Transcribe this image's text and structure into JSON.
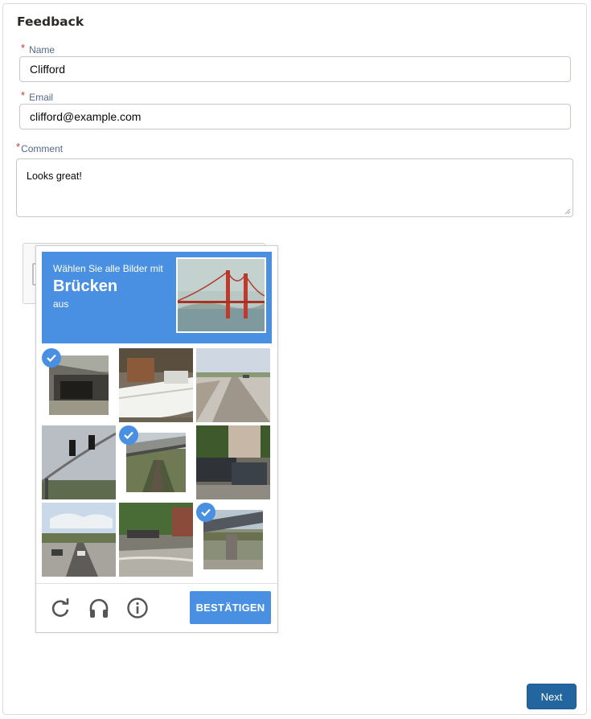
{
  "form": {
    "title": "Feedback",
    "required_mark": "*",
    "name_label": "Name",
    "name_value": "Clifford",
    "email_label": "Email",
    "email_value": "clifford@example.com",
    "comment_label": "Comment",
    "comment_value": "Looks great!",
    "next_label": "Next"
  },
  "captcha": {
    "instruction_line1": "Wählen Sie alle Bilder mit",
    "instruction_keyword": "Brücken",
    "instruction_line3": "aus",
    "verify_label": "BESTÄTIGEN",
    "accent_color": "#4a90e2",
    "tiles": [
      {
        "subject": "bridge-underpass",
        "selected": true
      },
      {
        "subject": "boat",
        "selected": false
      },
      {
        "subject": "highway",
        "selected": false
      },
      {
        "subject": "traffic-light",
        "selected": false
      },
      {
        "subject": "bridge-creek",
        "selected": true
      },
      {
        "subject": "parked-cars",
        "selected": false
      },
      {
        "subject": "street-traffic",
        "selected": false
      },
      {
        "subject": "street-corner",
        "selected": false
      },
      {
        "subject": "bridge-overpass",
        "selected": true
      }
    ],
    "footer_icons": [
      "reload-icon",
      "audio-icon",
      "info-icon"
    ]
  }
}
